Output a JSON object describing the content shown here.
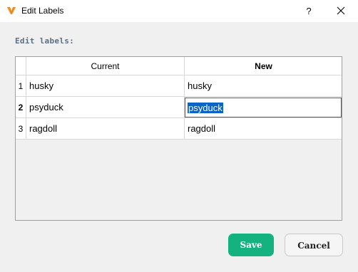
{
  "window": {
    "title": "Edit Labels",
    "help_glyph": "?",
    "accent_color": "#f08c1e"
  },
  "heading": "Edit labels:",
  "table": {
    "columns": [
      "Current",
      "New"
    ],
    "rows": [
      {
        "num": "1",
        "current": "husky",
        "new": "husky"
      },
      {
        "num": "2",
        "current": "psyduck",
        "new": "psyduck"
      },
      {
        "num": "3",
        "current": "ragdoll",
        "new": "ragdoll"
      }
    ],
    "active_row": "2"
  },
  "buttons": {
    "save": "Save",
    "cancel": "Cancel",
    "save_color": "#14b27e"
  },
  "icons": {
    "app": "app-logo-icon",
    "close": "close-icon"
  }
}
